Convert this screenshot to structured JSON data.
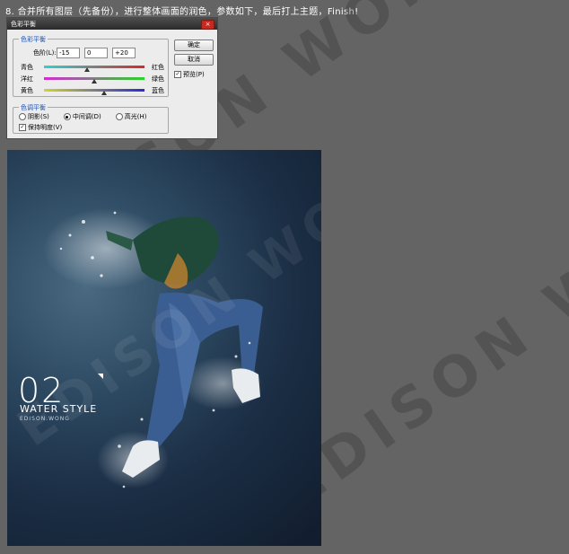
{
  "step_text": "8. 合并所有图层（先备份），进行整体画面的润色，参数如下，最后打上主题，Finish!",
  "watermark": "EDISON WONG 7",
  "dialog": {
    "title": "色彩平衡",
    "close_label": "×",
    "color_balance": {
      "legend": "色彩平衡",
      "levels_label": "色阶(L):",
      "levels": [
        "-15",
        "0",
        "+20"
      ],
      "sliders": [
        {
          "left": "青色",
          "right": "红色",
          "value": -15,
          "colors": [
            "#2ad4d4",
            "#d42a2a"
          ]
        },
        {
          "left": "洋红",
          "right": "绿色",
          "value": 0,
          "colors": [
            "#d42ad4",
            "#2ad42a"
          ]
        },
        {
          "left": "黄色",
          "right": "蓝色",
          "value": 20,
          "colors": [
            "#d4d42a",
            "#2a2ad4"
          ]
        }
      ]
    },
    "tone_balance": {
      "legend": "色调平衡",
      "options": [
        "阴影(S)",
        "中间调(D)",
        "高光(H)"
      ],
      "selected": "中间调(D)",
      "preserve_luminosity": "保持明度(V)"
    },
    "ok_label": "确定",
    "cancel_label": "取消",
    "preview_label": "预览(P)"
  },
  "artwork": {
    "number": "02",
    "title": "WATER STYLE",
    "subtitle": "EDISON.WONG"
  }
}
